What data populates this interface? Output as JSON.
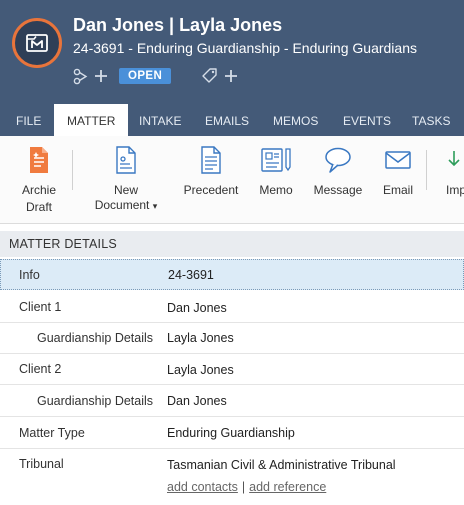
{
  "header": {
    "title": "Dan Jones | Layla Jones",
    "subtitle": "24-3691 - Enduring Guardianship - Enduring Guardians",
    "status": "OPEN",
    "icons": [
      "matter-logo-icon",
      "branch-add-icon",
      "tag-add-icon"
    ]
  },
  "tabs": [
    {
      "label": "FILE",
      "active": false
    },
    {
      "label": "MATTER",
      "active": true
    },
    {
      "label": "INTAKE",
      "active": false
    },
    {
      "label": "EMAILS",
      "active": false
    },
    {
      "label": "MEMOS",
      "active": false
    },
    {
      "label": "EVENTS",
      "active": false
    },
    {
      "label": "TASKS",
      "active": false
    }
  ],
  "ribbon": {
    "archie_line1": "Archie",
    "archie_line2": "Draft",
    "new_line1": "New",
    "new_line2": "Document",
    "new_caret": "▾",
    "precedent": "Precedent",
    "memo": "Memo",
    "message": "Message",
    "email": "Email",
    "import_partial": "Imp"
  },
  "section": {
    "title": "MATTER DETAILS"
  },
  "details": {
    "info_label": "Info",
    "info_value": "24-3691",
    "client1_label": "Client 1",
    "client1_value": "Dan Jones",
    "client1_guard_label": "Guardianship Details",
    "client1_guard_value": "Layla Jones",
    "client2_label": "Client 2",
    "client2_value": "Layla Jones",
    "client2_guard_label": "Guardianship Details",
    "client2_guard_value": "Dan Jones",
    "matter_type_label": "Matter Type",
    "matter_type_value": "Enduring Guardianship",
    "tribunal_label": "Tribunal",
    "tribunal_value": "Tasmanian Civil & Administrative Tribunal",
    "add_contacts": "add contacts",
    "separator": "|",
    "add_reference": "add reference"
  },
  "colors": {
    "header_bg": "#445a78",
    "avatar_ring": "#e8743b",
    "status_badge": "#4a90d9",
    "selected_row": "#dcebf7",
    "ribbon_icon_blue": "#3a78c2",
    "archie_orange": "#f07b3f"
  }
}
